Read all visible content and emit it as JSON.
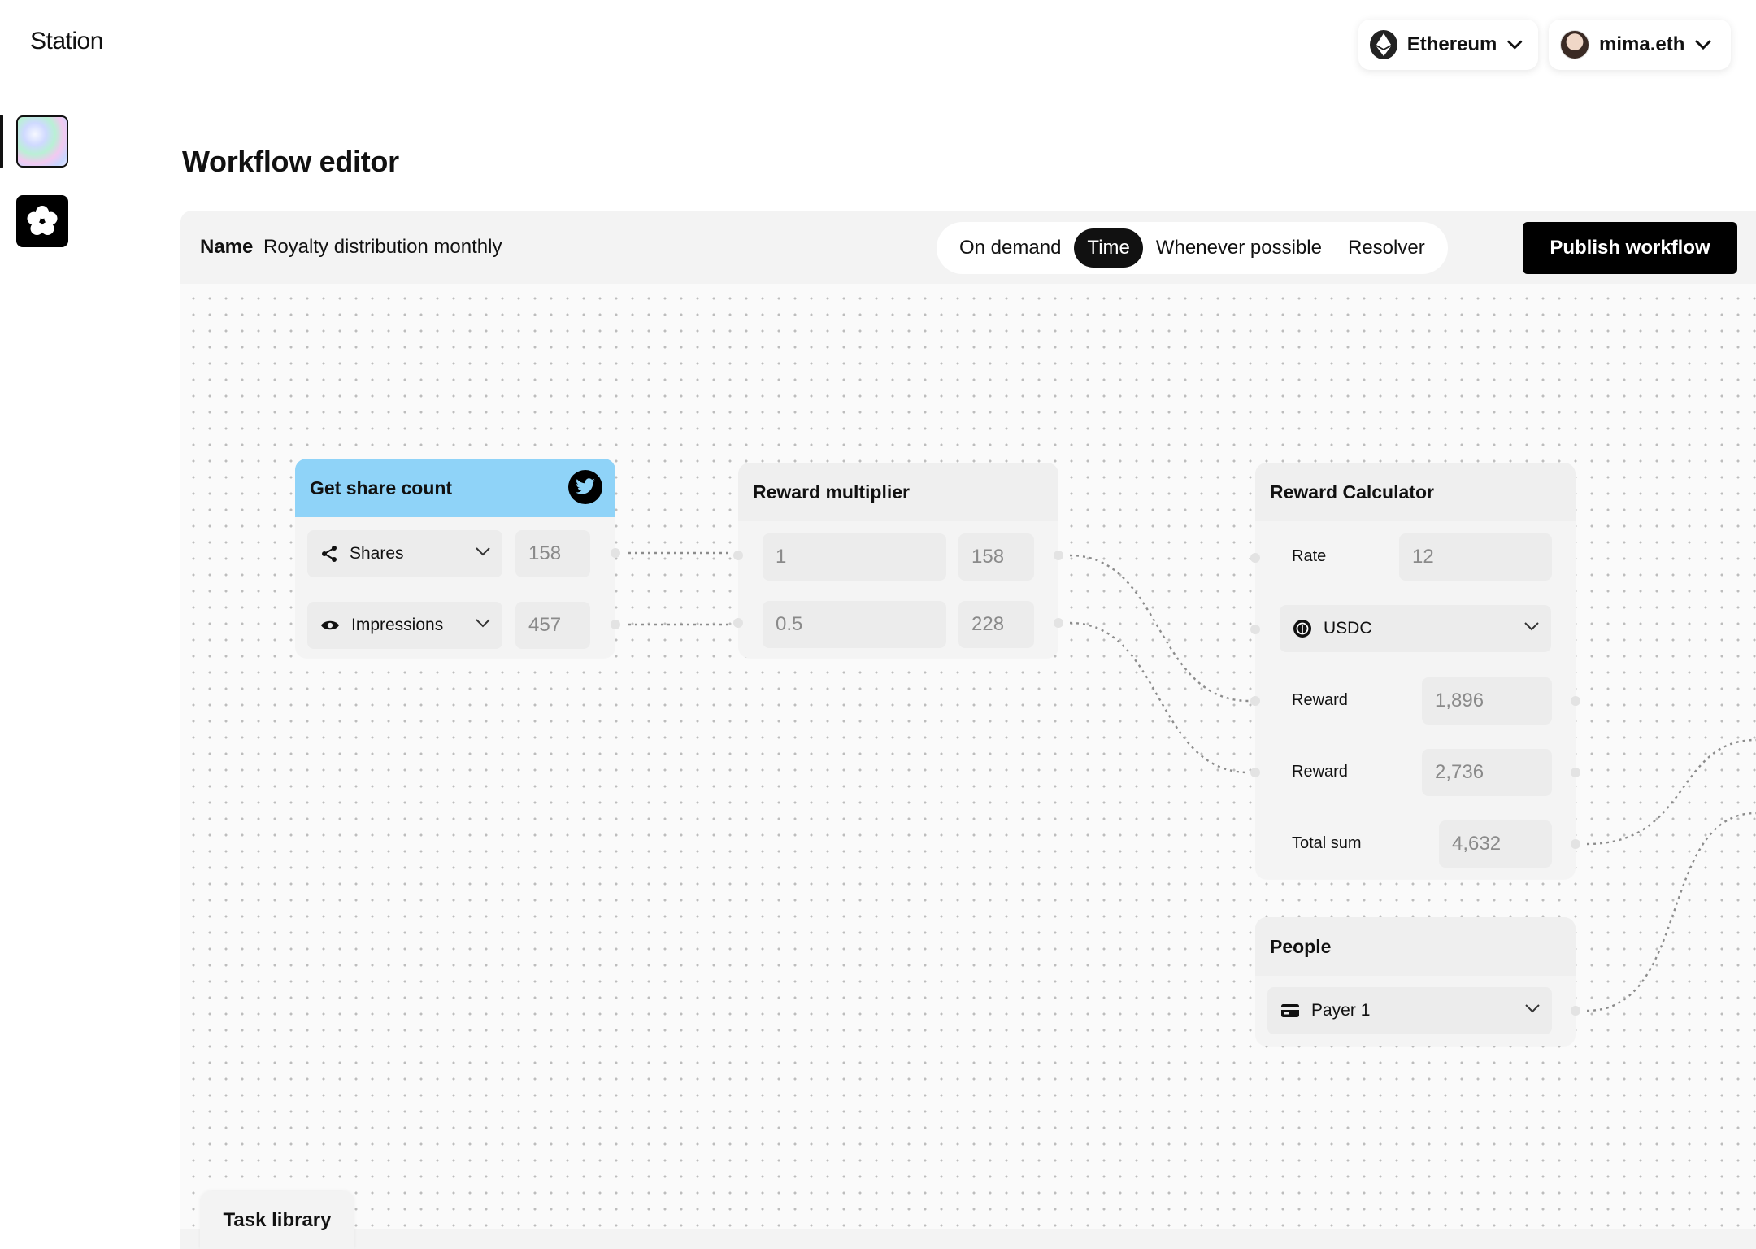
{
  "app": {
    "brand": "Station"
  },
  "header": {
    "network": {
      "label": "Ethereum",
      "icon": "ethereum-icon"
    },
    "account": {
      "label": "mima.eth",
      "icon": "avatar"
    }
  },
  "page": {
    "title": "Workflow editor"
  },
  "workflow": {
    "name_label": "Name",
    "name_value": "Royalty distribution monthly",
    "triggers": [
      "On demand",
      "Time",
      "Whenever possible",
      "Resolver"
    ],
    "active_trigger": "Time",
    "publish_label": "Publish workflow"
  },
  "nodes": {
    "share_count": {
      "title": "Get share count",
      "rows": [
        {
          "icon": "share-icon",
          "label": "Shares",
          "value": "158"
        },
        {
          "icon": "eye-icon",
          "label": "Impressions",
          "value": "457"
        }
      ]
    },
    "multiplier": {
      "title": "Reward multiplier",
      "rows": [
        {
          "factor": "1",
          "result": "158"
        },
        {
          "factor": "0.5",
          "result": "228"
        }
      ]
    },
    "calculator": {
      "title": "Reward Calculator",
      "rate_label": "Rate",
      "rate_value": "12",
      "token": "USDC",
      "reward1_label": "Reward",
      "reward1_value": "1,896",
      "reward2_label": "Reward",
      "reward2_value": "2,736",
      "total_label": "Total sum",
      "total_value": "4,632"
    },
    "people": {
      "title": "People",
      "payer": "Payer 1"
    }
  },
  "footer": {
    "task_library": "Task library"
  },
  "colors": {
    "accent": "#000000",
    "share_header": "#8fd3f8",
    "canvas": "#fafafa"
  }
}
